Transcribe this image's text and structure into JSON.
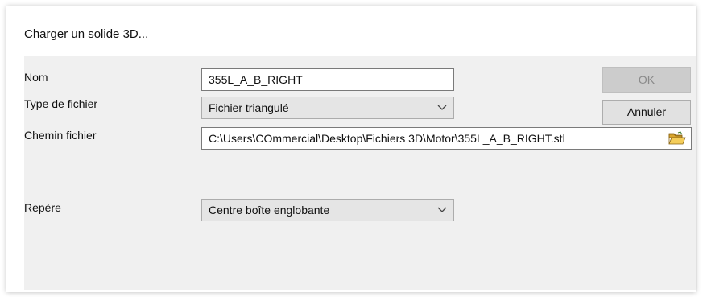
{
  "dialog": {
    "title": "Charger un solide 3D...",
    "fields": {
      "name_label": "Nom",
      "name_value": "355L_A_B_RIGHT",
      "filetype_label": "Type de fichier",
      "filetype_value": "Fichier triangulé",
      "path_label": "Chemin fichier",
      "path_value": "C:\\Users\\COmmercial\\Desktop\\Fichiers 3D\\Motor\\355L_A_B_RIGHT.stl",
      "frame_label": "Repère",
      "frame_value": "Centre boîte englobante"
    },
    "buttons": {
      "ok_label": "OK",
      "ok_enabled": false,
      "cancel_label": "Annuler"
    },
    "icons": {
      "folder": "open-folder-icon",
      "dropdown": "chevron-down-icon"
    },
    "colors": {
      "client_bg": "#f0f0f0",
      "folder_yellow": "#e8b73a"
    }
  }
}
